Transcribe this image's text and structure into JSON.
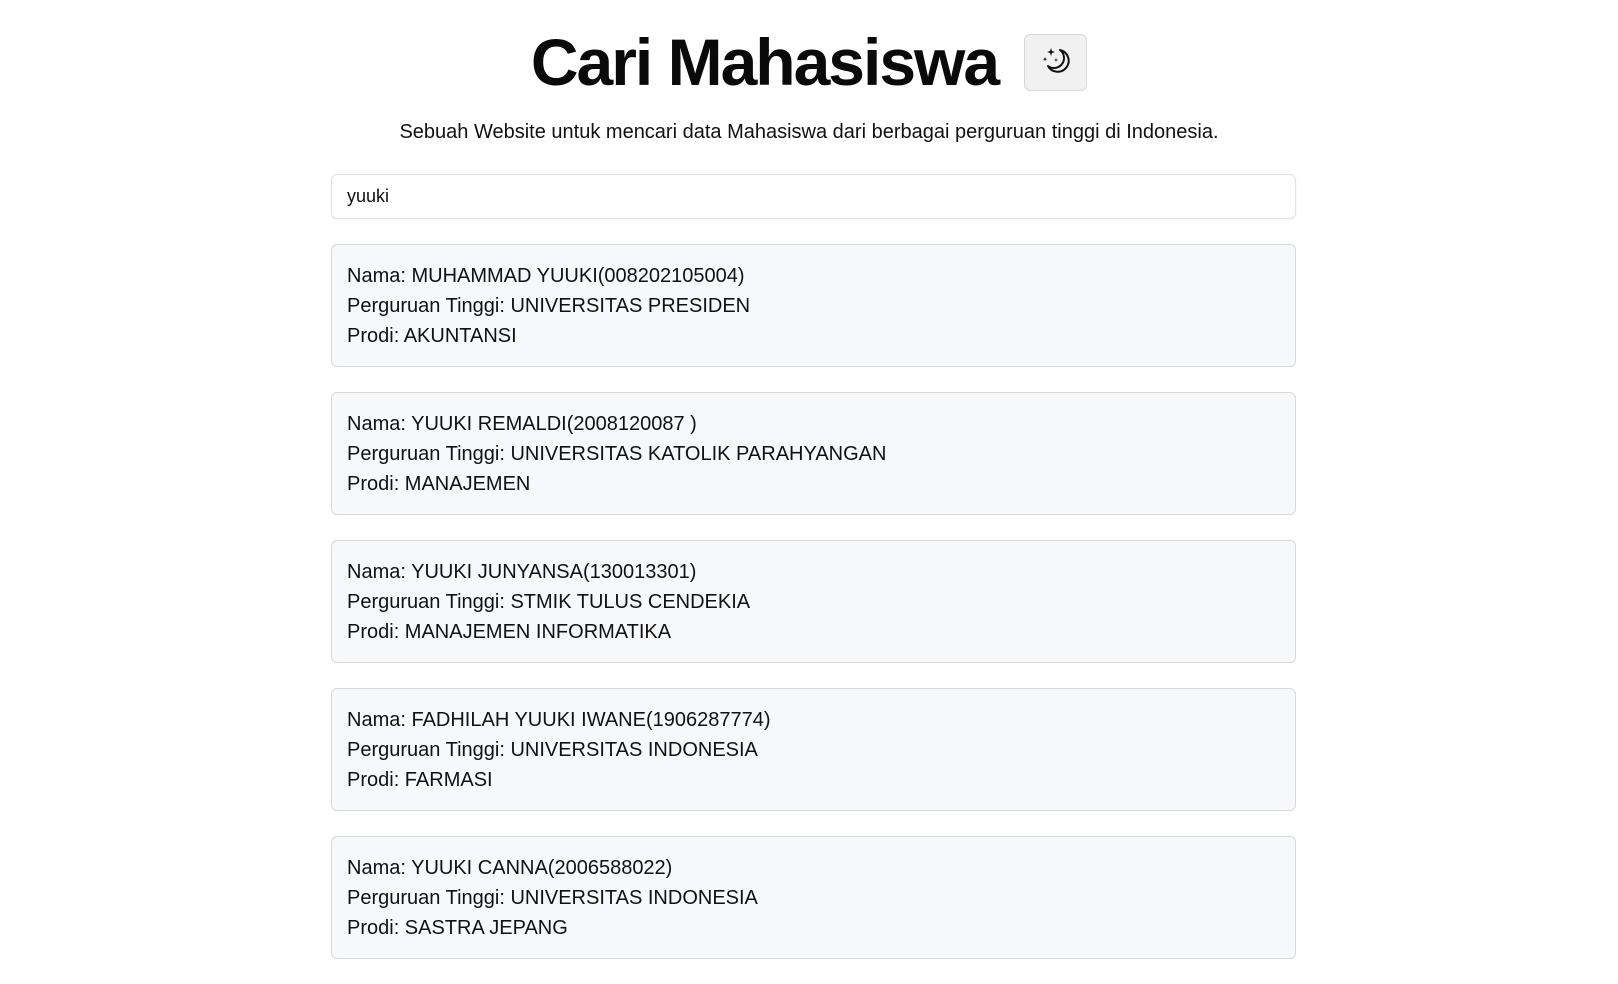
{
  "header": {
    "title": "Cari Mahasiswa",
    "theme_toggle_icon": "moon-stars-icon"
  },
  "subtitle": "Sebuah Website untuk mencari data Mahasiswa dari berbagai perguruan tinggi di Indonesia.",
  "search": {
    "value": "yuuki",
    "placeholder": ""
  },
  "results": [
    {
      "nama": "Nama: MUHAMMAD YUUKI(008202105004)",
      "pt": "Perguruan Tinggi: UNIVERSITAS PRESIDEN",
      "prodi": "Prodi: AKUNTANSI"
    },
    {
      "nama": "Nama: YUUKI REMALDI(2008120087 )",
      "pt": "Perguruan Tinggi: UNIVERSITAS KATOLIK PARAHYANGAN",
      "prodi": "Prodi: MANAJEMEN"
    },
    {
      "nama": "Nama: YUUKI JUNYANSA(130013301)",
      "pt": "Perguruan Tinggi: STMIK TULUS CENDEKIA",
      "prodi": "Prodi: MANAJEMEN INFORMATIKA"
    },
    {
      "nama": "Nama: FADHILAH YUUKI IWANE(1906287774)",
      "pt": "Perguruan Tinggi: UNIVERSITAS INDONESIA",
      "prodi": "Prodi: FARMASI"
    },
    {
      "nama": "Nama: YUUKI CANNA(2006588022)",
      "pt": "Perguruan Tinggi: UNIVERSITAS INDONESIA",
      "prodi": "Prodi: SASTRA JEPANG"
    }
  ]
}
